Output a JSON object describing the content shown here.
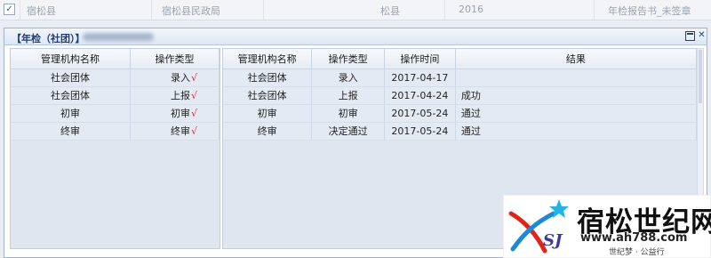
{
  "background_row": {
    "checkbox": "✓",
    "cells": [
      "宿松县",
      "宿松县民政局",
      "松县",
      "2016",
      "年检报告书_未签章"
    ]
  },
  "dialog": {
    "title": "【年检（社团）】",
    "title_color": "#1f3f76"
  },
  "left_table": {
    "headers": [
      "管理机构名称",
      "操作类型"
    ],
    "rows": [
      {
        "org": "社会团体",
        "type": "录入",
        "mark": "√"
      },
      {
        "org": "社会团体",
        "type": "上报",
        "mark": "√"
      },
      {
        "org": "初审",
        "type": "初审",
        "mark": "√"
      },
      {
        "org": "终审",
        "type": "终审",
        "mark": "√"
      }
    ]
  },
  "right_table": {
    "headers": [
      "管理机构名称",
      "操作类型",
      "操作时间",
      "结果"
    ],
    "rows": [
      {
        "org": "社会团体",
        "type": "录入",
        "time": "2017-04-17",
        "result": ""
      },
      {
        "org": "社会团体",
        "type": "上报",
        "time": "2017-04-24",
        "result": "成功"
      },
      {
        "org": "初审",
        "type": "初审",
        "time": "2017-05-24",
        "result": "通过"
      },
      {
        "org": "终审",
        "type": "决定通过",
        "time": "2017-05-24",
        "result": "通过"
      }
    ]
  },
  "watermark": {
    "name": "宿松世纪网",
    "url": "www.ah788.com",
    "slogan": "世纪梦 · 公益行",
    "logo_text": "SJ"
  },
  "colors": {
    "check_mark": "#e0262b",
    "logo_red": "#e2231a",
    "logo_blue": "#1e88d8",
    "logo_star": "#22b3e6"
  }
}
